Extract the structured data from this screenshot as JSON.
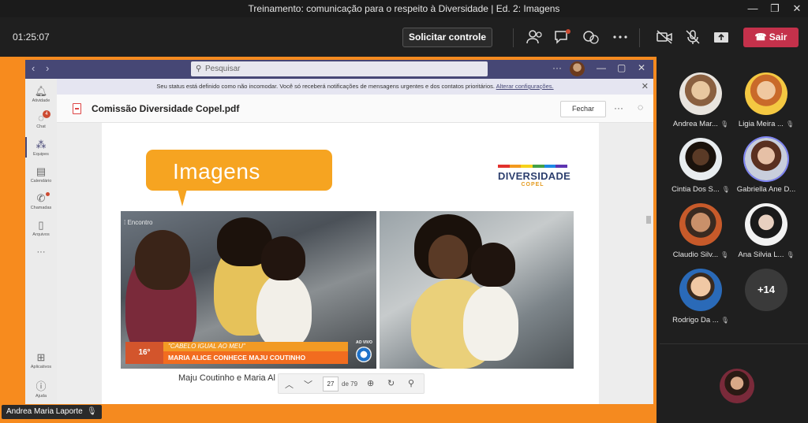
{
  "window": {
    "title": "Treinamento: comunicação para o respeito à Diversidade | Ed. 2: Imagens"
  },
  "meeting": {
    "timer": "01:25:07",
    "request_control_label": "Solicitar controle",
    "leave_label": "Sair",
    "leave_color": "#c4314b"
  },
  "teams": {
    "search_placeholder": "Pesquisar",
    "rail": [
      {
        "label": "Atividade",
        "icon": "bell-icon"
      },
      {
        "label": "Chat",
        "icon": "chat-icon",
        "badge": "4"
      },
      {
        "label": "Equipes",
        "icon": "teams-icon"
      },
      {
        "label": "Calendário",
        "icon": "calendar-icon"
      },
      {
        "label": "Chamadas",
        "icon": "phone-icon"
      },
      {
        "label": "Arquivos",
        "icon": "file-icon"
      },
      {
        "label": "Aplicativos",
        "icon": "apps-icon"
      },
      {
        "label": "Ajuda",
        "icon": "help-icon"
      }
    ],
    "notice_text": "Seu status está definido como não incomodar. Você só receberá notificações de mensagens urgentes e dos contatos prioritários.",
    "notice_link": "Alterar configurações.",
    "doc_title": "Comissão Diversidade Copel.pdf",
    "close_label": "Fechar",
    "brand_color": "#464775"
  },
  "slide": {
    "heading": "Imagens",
    "logo_word": "DIVERSIDADE",
    "logo_sub": "COPEL",
    "logo_colors": [
      "#e2312d",
      "#f39a1e",
      "#f6d21a",
      "#43a047",
      "#1e88e5",
      "#5e35b1"
    ],
    "photo1": {
      "watermark": "Encontro",
      "temp": "16°",
      "lower_top": "\"CABELO IGUAL AO MEU\"",
      "lower_bottom": "MARIA ALICE CONHECE MAJU COUTINHO",
      "live_label": "AO VIVO"
    },
    "caption": "Maju Coutinho e Maria Al"
  },
  "pager": {
    "current_page": "27",
    "of_text": "de 79"
  },
  "presenter": {
    "name": "Andrea Maria Laporte"
  },
  "participants": [
    {
      "name": "Andrea Mar...",
      "muted": true
    },
    {
      "name": "Ligia Meira ...",
      "muted": true
    },
    {
      "name": "Cintia Dos S...",
      "muted": true
    },
    {
      "name": "Gabriella Ane D...",
      "muted": false,
      "speaking": true
    },
    {
      "name": "Claudio Silv...",
      "muted": true
    },
    {
      "name": "Ana Silvia L...",
      "muted": true
    },
    {
      "name": "Rodrigo Da ...",
      "muted": true
    }
  ],
  "overflow_count": "+14"
}
